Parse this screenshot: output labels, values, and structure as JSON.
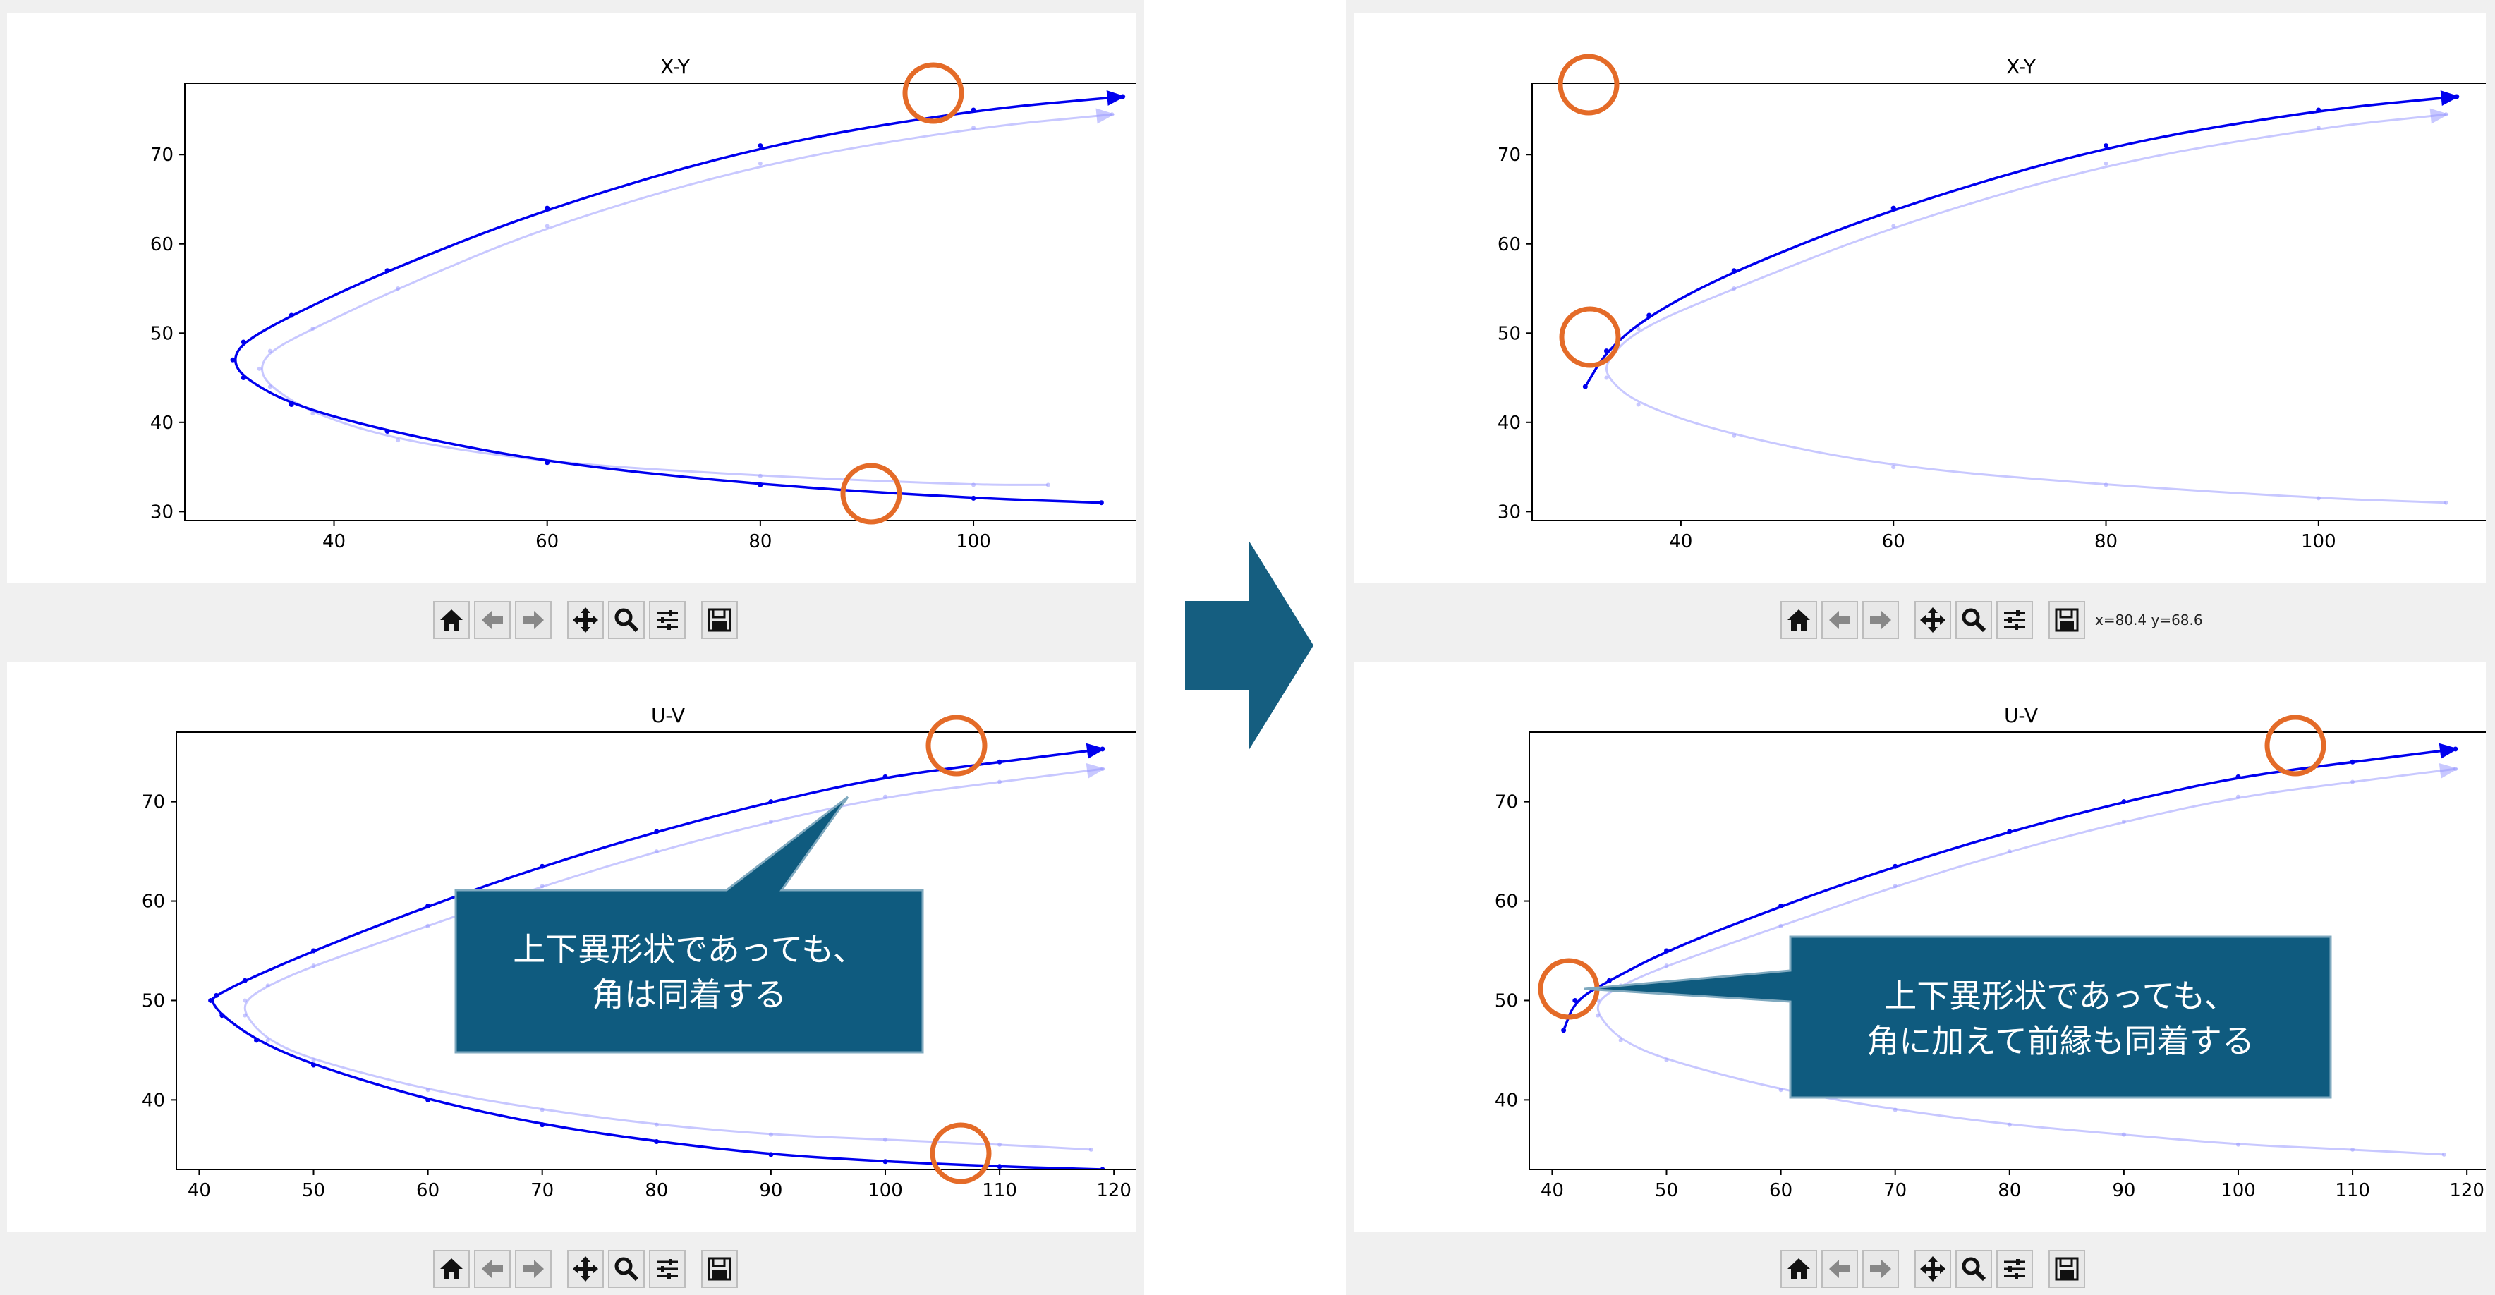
{
  "colors": {
    "curve_primary": "#0000ee",
    "curve_ghost": "#9a9aff",
    "highlight_ring": "#e46b28",
    "callout_fill": "#0f5b7f",
    "arrow_fill": "#155e80",
    "panel_bg": "#f0f0f0"
  },
  "toolbar_icons": [
    "home-icon",
    "back-icon",
    "forward-icon",
    "pan-icon",
    "zoom-icon",
    "configure-subplots-icon",
    "save-icon"
  ],
  "status": {
    "coordinates": "x=80.4 y=68.6"
  },
  "callouts": {
    "left": {
      "line1": "上下異形状であっても、",
      "line2": "角は同着する"
    },
    "right": {
      "line1": "上下異形状であっても、",
      "line2": "角に加えて前縁も同着する"
    }
  },
  "plots": {
    "left_xy": {
      "title": "X-Y",
      "xticks": [
        "40",
        "60",
        "80",
        "100"
      ],
      "yticks": [
        "30",
        "40",
        "50",
        "60",
        "70"
      ],
      "chart_data": {
        "type": "line",
        "title": "X-Y",
        "xlim": [
          26,
          118
        ],
        "ylim": [
          29,
          78
        ],
        "series": [
          {
            "style": "solid",
            "x": [
              114,
              100,
              80,
              60,
              45,
              36,
              31.5,
              30.5,
              31.5,
              36,
              45,
              60,
              80,
              100,
              112
            ],
            "y": [
              76.5,
              75,
              71,
              64,
              57,
              52,
              49,
              47,
              45,
              42,
              39,
              35.5,
              33,
              31.5,
              31
            ]
          },
          {
            "style": "ghost",
            "x": [
              113,
              100,
              80,
              60,
              46,
              38,
              34,
              33,
              34,
              38,
              46,
              60,
              80,
              100,
              107
            ],
            "y": [
              74.5,
              73,
              69,
              62,
              55,
              50.5,
              48,
              46,
              44,
              41,
              38,
              35.5,
              34,
              33,
              33
            ]
          }
        ]
      }
    },
    "right_xy": {
      "title": "X-Y",
      "xticks": [
        "40",
        "60",
        "80",
        "100"
      ],
      "yticks": [
        "30",
        "40",
        "50",
        "60",
        "70"
      ],
      "chart_data": {
        "type": "line",
        "title": "X-Y",
        "xlim": [
          26,
          118
        ],
        "ylim": [
          29,
          78
        ],
        "series": [
          {
            "style": "solid",
            "x": [
              113,
              100,
              80,
              60,
              45,
              37,
              33,
              31
            ],
            "y": [
              76.5,
              75,
              71,
              64,
              57,
              52,
              48,
              44
            ]
          },
          {
            "style": "ghost",
            "x": [
              112,
              100,
              80,
              60,
              45,
              36,
              33,
              33,
              36,
              45,
              60,
              80,
              100,
              112
            ],
            "y": [
              74.5,
              73,
              69,
              62,
              55,
              50.5,
              47,
              45,
              42,
              38.5,
              35,
              33,
              31.5,
              31
            ]
          }
        ]
      }
    },
    "left_uv": {
      "title": "U-V",
      "xticks": [
        "40",
        "50",
        "60",
        "70",
        "80",
        "90",
        "100",
        "110",
        "120"
      ],
      "yticks": [
        "40",
        "50",
        "60",
        "70"
      ],
      "chart_data": {
        "type": "line",
        "title": "U-V",
        "xlim": [
          38,
          124
        ],
        "ylim": [
          33,
          77
        ],
        "series": [
          {
            "style": "solid",
            "x": [
              119,
              110,
              100,
              90,
              80,
              70,
              60,
              50,
              44,
              41.5,
              41,
              42,
              45,
              50,
              60,
              70,
              80,
              90,
              100,
              110,
              119
            ],
            "y": [
              75.3,
              74,
              72.5,
              70,
              67,
              63.5,
              59.5,
              55,
              52,
              50.5,
              50,
              48.5,
              46,
              43.5,
              40,
              37.5,
              35.8,
              34.5,
              33.8,
              33.3,
              33
            ]
          },
          {
            "style": "ghost",
            "x": [
              119,
              110,
              100,
              90,
              80,
              70,
              60,
              50,
              46,
              44,
              44,
              46,
              50,
              60,
              70,
              80,
              90,
              100,
              110,
              118
            ],
            "y": [
              73.3,
              72,
              70.5,
              68,
              65,
              61.5,
              57.5,
              53.5,
              51.5,
              50,
              48.5,
              46,
              44,
              41,
              39,
              37.5,
              36.5,
              36,
              35.5,
              35
            ]
          }
        ]
      }
    },
    "right_uv": {
      "title": "U-V",
      "xticks": [
        "40",
        "50",
        "60",
        "70",
        "80",
        "90",
        "100",
        "110",
        "120"
      ],
      "yticks": [
        "40",
        "50",
        "60",
        "70"
      ],
      "chart_data": {
        "type": "line",
        "title": "U-V",
        "xlim": [
          38,
          124
        ],
        "ylim": [
          33,
          77
        ],
        "series": [
          {
            "style": "solid",
            "x": [
              119,
              110,
              100,
              90,
              80,
              70,
              60,
              50,
              45,
              42,
              41
            ],
            "y": [
              75.3,
              74,
              72.5,
              70,
              67,
              63.5,
              59.5,
              55,
              52,
              50,
              47
            ]
          },
          {
            "style": "ghost",
            "x": [
              119,
              110,
              100,
              90,
              80,
              70,
              60,
              50,
              46,
              44,
              44,
              46,
              50,
              60,
              70,
              80,
              90,
              100,
              110,
              118
            ],
            "y": [
              73.3,
              72,
              70.5,
              68,
              65,
              61.5,
              57.5,
              53.5,
              51.5,
              50,
              48.5,
              46,
              44,
              41,
              39,
              37.5,
              36.5,
              35.5,
              35,
              34.5
            ]
          }
        ]
      }
    }
  }
}
